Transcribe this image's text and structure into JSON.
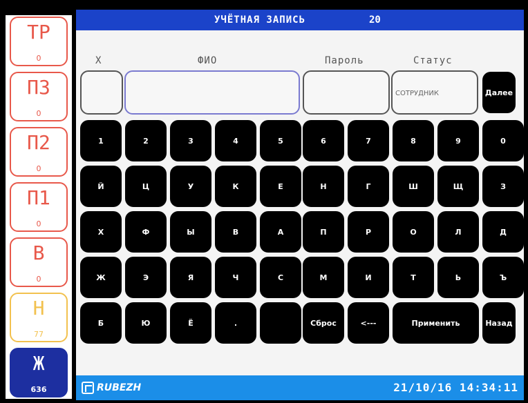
{
  "title": "УЧЁТНАЯ ЗАПИСЬ",
  "record_number": "20",
  "sidebar": {
    "buttons": [
      {
        "label": "ТР",
        "count": "0"
      },
      {
        "label": "П3",
        "count": "0"
      },
      {
        "label": "П2",
        "count": "0"
      },
      {
        "label": "П1",
        "count": "0"
      },
      {
        "label": "В",
        "count": "0"
      },
      {
        "label": "Н",
        "count": "77"
      },
      {
        "label": "Ж",
        "count": "636"
      }
    ]
  },
  "headers": {
    "x": "Х",
    "fio": "ФИО",
    "password": "Пароль",
    "status": "Статус"
  },
  "fields": {
    "x": "",
    "fio": "",
    "password": "",
    "status": "СОТРУДНИК"
  },
  "keyboard": {
    "next": "Далее",
    "rows": [
      [
        "1",
        "2",
        "3",
        "4",
        "5",
        "6",
        "7",
        "8",
        "9",
        "0"
      ],
      [
        "Й",
        "Ц",
        "У",
        "К",
        "Е",
        "Н",
        "Г",
        "Ш",
        "Щ",
        "З"
      ],
      [
        "Х",
        "Ф",
        "Ы",
        "В",
        "А",
        "П",
        "Р",
        "О",
        "Л",
        "Д"
      ],
      [
        "Ж",
        "Э",
        "Я",
        "Ч",
        "С",
        "М",
        "И",
        "Т",
        "Ь",
        "Ъ"
      ]
    ],
    "bottom": {
      "b": "Б",
      "yu": "Ю",
      "yo": "Ё",
      "dot": ".",
      "space": "",
      "reset": "Сброс",
      "backspace": "<---",
      "apply": "Применить",
      "back": "Назад"
    }
  },
  "status_bar": {
    "logo": "RUBEZH",
    "datetime": "21/10/16 14:34:11"
  },
  "colors": {
    "title_bar": "#1b43c9",
    "status_bar": "#1b8ee8",
    "alarm": "#e8584a",
    "warning": "#f2c14e",
    "selected": "#1d2fa0"
  }
}
